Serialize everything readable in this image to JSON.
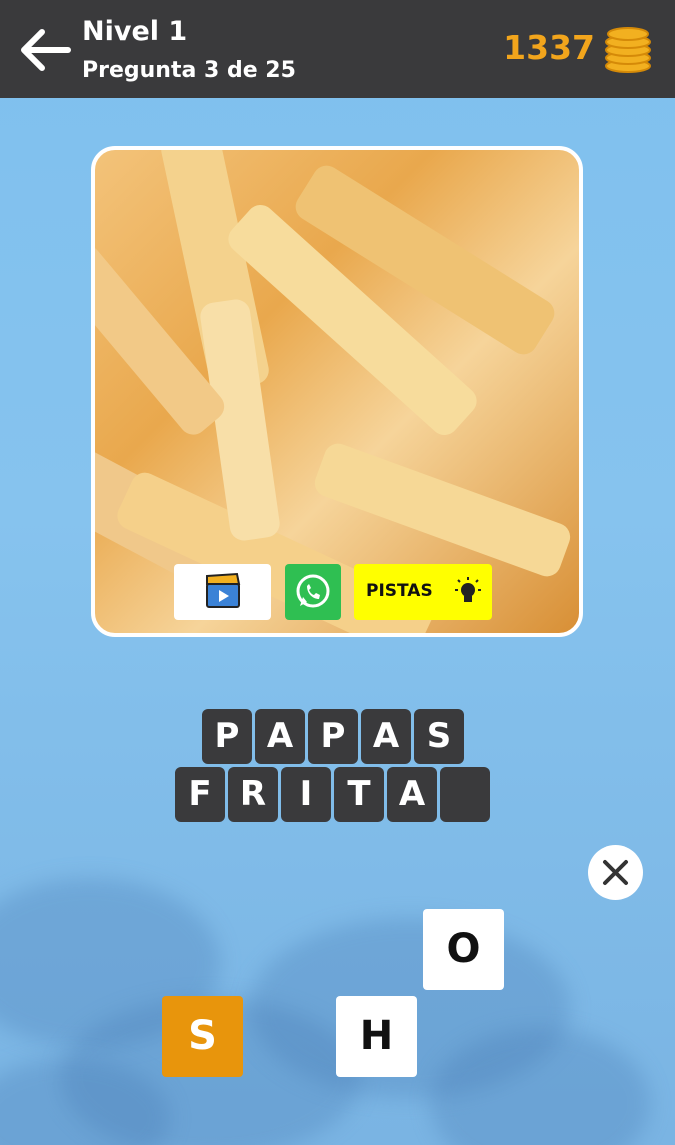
{
  "header": {
    "title": "Nivel 1",
    "subtitle": "Pregunta 3 de 25",
    "coins": "1337"
  },
  "tools": {
    "hints_label": "PISTAS"
  },
  "answer": {
    "row1": [
      "P",
      "A",
      "P",
      "A",
      "S"
    ],
    "row2": [
      "F",
      "R",
      "I",
      "T",
      "A",
      ""
    ]
  },
  "letters": [
    "O",
    "S",
    "H"
  ],
  "colors": {
    "header_bg": "#3a3a3c",
    "coin_gold": "#f2a51c",
    "tile_bg": "#3a3a3c",
    "hint_yellow": "#ffff00",
    "whatsapp_green": "#2fbf52",
    "selected_letter": "#e8950c"
  },
  "icons": [
    "back-arrow-icon",
    "coin-stack-icon",
    "video-clapper-icon",
    "whatsapp-icon",
    "lightbulb-icon",
    "close-icon"
  ]
}
